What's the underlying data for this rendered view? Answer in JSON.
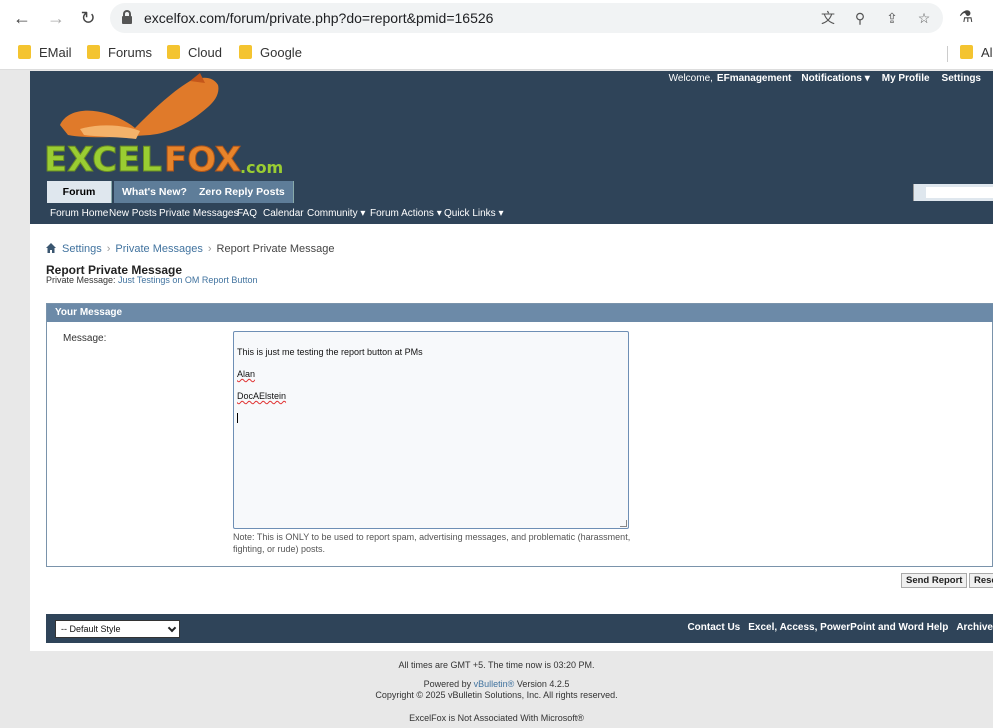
{
  "browser": {
    "url": "excelfox.com/forum/private.php?do=report&pmid=16526",
    "bookmarks": [
      "EMail",
      "Forums",
      "Cloud",
      "Google",
      "Al"
    ]
  },
  "header": {
    "welcome": "Welcome,",
    "username": "EFmanagement",
    "notifications": "Notifications ▾",
    "my_profile": "My Profile",
    "settings": "Settings",
    "logo_text_excel": "EXCEL",
    "logo_text_fox": "FOX",
    "logo_text_com": ".com"
  },
  "tabs": [
    "Forum",
    "What's New?",
    "Zero Reply Posts"
  ],
  "subnav": [
    "Forum Home",
    "New Posts",
    "Private Messages",
    "FAQ",
    "Calendar",
    "Community ▾",
    "Forum Actions ▾",
    "Quick Links ▾"
  ],
  "breadcrumb": {
    "items": [
      "Settings",
      "Private Messages",
      "Report Private Message"
    ]
  },
  "page": {
    "title": "Report Private Message",
    "subtitle_label": "Private Message:",
    "subtitle_link": "Just Testings on OM Report Button"
  },
  "form": {
    "panel_title": "Your Message",
    "message_label": "Message:",
    "message_lines": [
      "This is just me testing the report button at PMs",
      "Alan",
      "DocAElstein"
    ],
    "note": "Note: This is ONLY to be used to report spam, advertising messages, and problematic (harassment, fighting, or rude) posts.",
    "send_button": "Send Report",
    "reset_button": "Reset"
  },
  "footer": {
    "style_select": "-- Default Style",
    "contact": "Contact Us",
    "help": "Excel, Access, PowerPoint and Word Help",
    "archive": "Archive",
    "times": "All times are GMT +5. The time now is 03:20 PM.",
    "powered_prefix": "Powered by",
    "powered_link": "vBulletin®",
    "powered_version": "Version 4.2.5",
    "copyright": "Copyright © 2025 vBulletin Solutions, Inc. All rights reserved.",
    "disclaimer": "ExcelFox is Not Associated With Microsoft®"
  }
}
